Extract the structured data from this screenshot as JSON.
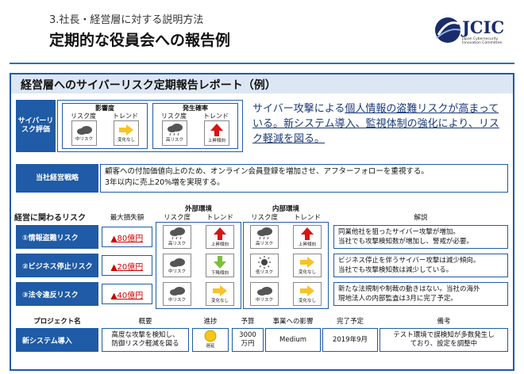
{
  "header": {
    "subtitle": "3.社長・経営層に対する説明方法",
    "title": "定期的な役員会への報告例",
    "logo_text": "JCIC",
    "logo_sub": "Japan Cybersecurity Innovation Committee"
  },
  "panel_title": "経営層へのサイバーリスク定期報告レポート（例）",
  "cyber_eval": {
    "label": "サイバーリスク評価",
    "impact": {
      "title": "影響度",
      "risk_h": "リスク度",
      "trend_h": "トレンド",
      "risk_icon": "cloud-icon",
      "risk_label": "中リスク",
      "trend_icon": "arrow-right-icon",
      "trend_label": "変化なし"
    },
    "probability": {
      "title": "発生確率",
      "risk_h": "リスク度",
      "trend_h": "トレンド",
      "risk_icon": "rain-cloud-icon",
      "risk_label": "高リスク",
      "trend_icon": "arrow-up-icon",
      "trend_label": "上昇傾向"
    },
    "summary_pre": "サイバー攻撃による",
    "summary_u1": "個人情報の盗難リスクが高まっている。",
    "summary_u2": "新システム導入、監視体制の強化により、リスク軽減を図る。"
  },
  "strategy": {
    "label": "当社経営戦略",
    "line1": "顧客への付加価値向上のため、オンライン会員登録を増加させ、アフターフォローを重視する。",
    "line2": "3年以内に売上20%増を実現する。"
  },
  "risks": {
    "section_label": "経営に関わるリスク",
    "max_loss_h": "最大損失額",
    "external_h": "外部環境",
    "internal_h": "内部環境",
    "risk_h": "リスク度",
    "trend_h": "トレンド",
    "comment_h": "解説",
    "rows": [
      {
        "label": "①情報盗難リスク",
        "loss": "▲80億円",
        "ext_risk": "高リスク",
        "ext_risk_icon": "rain-cloud-icon",
        "ext_trend": "上昇傾向",
        "ext_trend_icon": "arrow-up-icon",
        "int_risk": "高リスク",
        "int_risk_icon": "rain-cloud-icon",
        "int_trend": "上昇傾向",
        "int_trend_icon": "arrow-up-icon",
        "comment1": "同業他社を狙ったサイバー攻撃が増加。",
        "comment2": "当社でも攻撃検知数が増加し、警戒が必要。"
      },
      {
        "label": "②ビジネス停止リスク",
        "loss": "▲20億円",
        "ext_risk": "中リスク",
        "ext_risk_icon": "cloud-icon",
        "ext_trend": "下降傾向",
        "ext_trend_icon": "arrow-down-icon",
        "int_risk": "低リスク",
        "int_risk_icon": "sun-icon",
        "int_trend": "変化なし",
        "int_trend_icon": "arrow-right-icon",
        "comment1": "ビジネス停止を伴うサイバー攻撃は減少傾向。",
        "comment2": "当社でも攻撃検知数は減少している。"
      },
      {
        "label": "③法令違反リスク",
        "loss": "▲40億円",
        "ext_risk": "中リスク",
        "ext_risk_icon": "cloud-icon",
        "ext_trend": "変化なし",
        "ext_trend_icon": "arrow-right-icon",
        "int_risk": "中リスク",
        "int_risk_icon": "cloud-icon",
        "int_trend": "変化なし",
        "int_trend_icon": "arrow-right-icon",
        "comment1": "新たな法規制や制裁の動きはない。当社の海外",
        "comment2": "現地法人の内部監査は3月に完了予定。"
      }
    ]
  },
  "project": {
    "headers": {
      "name": "プロジェクト名",
      "overview": "概要",
      "progress": "進捗",
      "budget": "予算",
      "impact": "事業への影響",
      "deadline": "完了予定",
      "note": "備考"
    },
    "row": {
      "name": "新システム導入",
      "overview1": "高度な攻撃を検知し、",
      "overview2": "防御リスク軽減を図る",
      "progress": "遅延",
      "progress_color": "#f5c518",
      "budget1": "3000",
      "budget2": "万円",
      "impact": "Medium",
      "deadline": "2019年9月",
      "note1": "テスト環境で誤検知が多数発生し",
      "note2": "ており、設定を調整中"
    }
  },
  "colors": {
    "accent": "#1f5ba6",
    "up": "#d61515",
    "down": "#7cbf3c",
    "flat": "#f7c325",
    "loss": "#cc0000"
  }
}
